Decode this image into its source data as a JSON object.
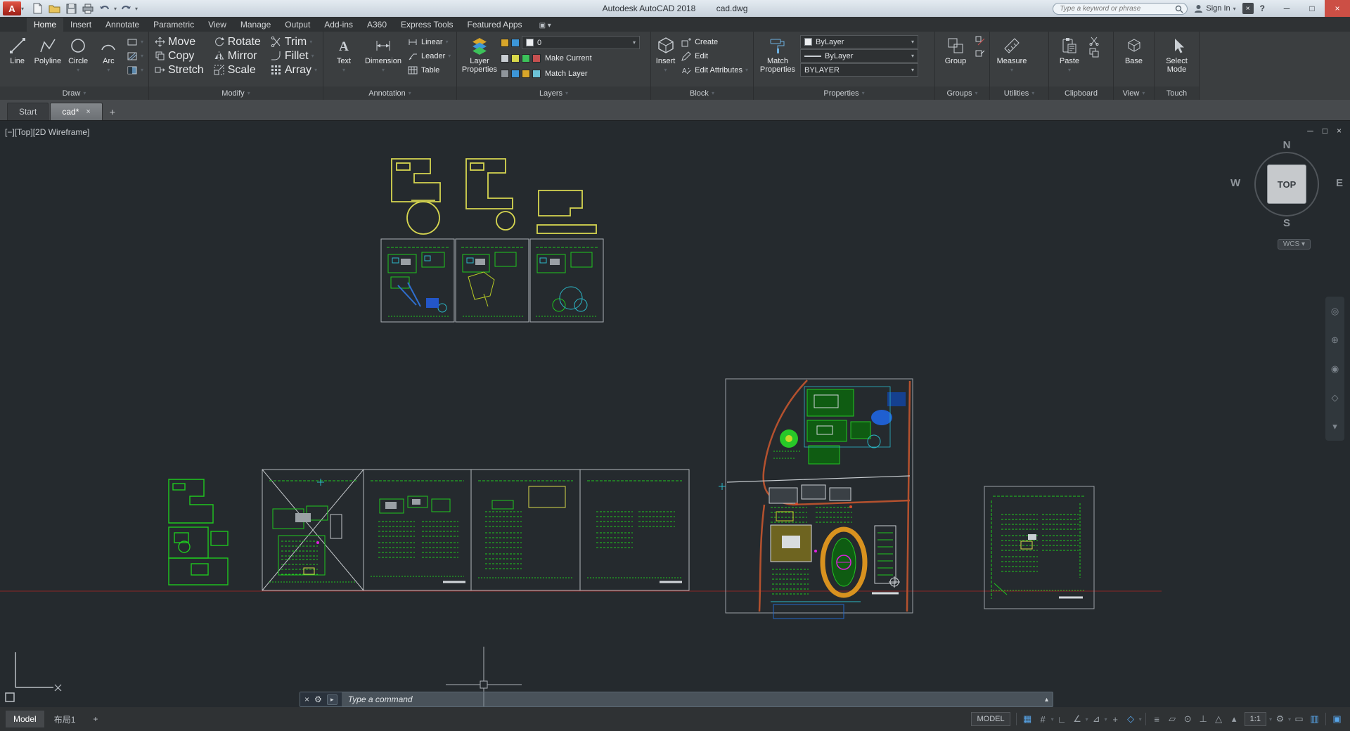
{
  "title_bar": {
    "logo": "A",
    "app_title": "Autodesk AutoCAD 2018",
    "doc_title": "cad.dwg",
    "search_placeholder": "Type a keyword or phrase",
    "sign_in_label": "Sign In",
    "help_label": "?"
  },
  "ribbon": {
    "tabs": [
      "Home",
      "Insert",
      "Annotate",
      "Parametric",
      "View",
      "Manage",
      "Output",
      "Add-ins",
      "A360",
      "Express Tools",
      "Featured Apps"
    ],
    "panels": {
      "draw": {
        "label": "Draw",
        "line": "Line",
        "polyline": "Polyline",
        "circle": "Circle",
        "arc": "Arc"
      },
      "modify": {
        "label": "Modify",
        "move": "Move",
        "rotate": "Rotate",
        "trim": "Trim",
        "copy": "Copy",
        "mirror": "Mirror",
        "fillet": "Fillet",
        "stretch": "Stretch",
        "scale": "Scale",
        "array": "Array"
      },
      "annotation": {
        "label": "Annotation",
        "text": "Text",
        "dimension": "Dimension",
        "linear": "Linear",
        "leader": "Leader",
        "table": "Table"
      },
      "layers": {
        "label": "Layers",
        "layer_properties": "Layer Properties",
        "make_current": "Make Current",
        "match_layer": "Match Layer",
        "current_layer": "0"
      },
      "block": {
        "label": "Block",
        "insert": "Insert",
        "create": "Create",
        "edit": "Edit",
        "edit_attributes": "Edit Attributes"
      },
      "properties": {
        "label": "Properties",
        "match_properties": "Match Properties",
        "color": "ByLayer",
        "linetype": "ByLayer",
        "lineweight": "BYLAYER"
      },
      "groups": {
        "label": "Groups",
        "group": "Group"
      },
      "utilities": {
        "label": "Utilities",
        "measure": "Measure"
      },
      "clipboard": {
        "label": "Clipboard",
        "paste": "Paste"
      },
      "view": {
        "label": "View",
        "base": "Base"
      },
      "touch": {
        "label": "Touch",
        "select_mode": "Select Mode"
      }
    }
  },
  "file_tabs": {
    "start": "Start",
    "document": "cad*",
    "close": "×",
    "add": "+"
  },
  "viewport": {
    "controls_label": "[−][Top][2D Wireframe]",
    "viewcube": {
      "north": "N",
      "east": "E",
      "south": "S",
      "west": "W",
      "face": "TOP"
    },
    "wcs_label": "WCS"
  },
  "command_line": {
    "prompt_placeholder": "Type a command"
  },
  "status_bar": {
    "model_tab": "Model",
    "layout_tab": "布局1",
    "add_layout": "+",
    "model_space_label": "MODEL",
    "annotation_scale": "1:1",
    "icons": [
      {
        "name": "grid-display",
        "glyph": "▦",
        "active": true
      },
      {
        "name": "snap-mode",
        "glyph": "#",
        "active": false
      },
      {
        "name": "ortho-mode",
        "glyph": "∟",
        "active": false
      },
      {
        "name": "polar-tracking",
        "glyph": "∠",
        "active": false
      },
      {
        "name": "isometric-drafting",
        "glyph": "⊿",
        "active": false
      },
      {
        "name": "object-snap-tracking",
        "glyph": "+",
        "active": false
      },
      {
        "name": "object-snap",
        "glyph": "◇",
        "active": true
      },
      {
        "name": "lineweight",
        "glyph": "≡",
        "active": false
      },
      {
        "name": "transparency",
        "glyph": "▱",
        "active": false
      },
      {
        "name": "selection-cycling",
        "glyph": "⊙",
        "active": false
      },
      {
        "name": "dynamic-ucs",
        "glyph": "⊥",
        "active": false
      },
      {
        "name": "annotation-visibility",
        "glyph": "△",
        "active": false
      },
      {
        "name": "autoscale",
        "glyph": "▴",
        "active": false
      },
      {
        "name": "workspace-switching",
        "glyph": "⚙",
        "active": false
      },
      {
        "name": "annotation-monitor",
        "glyph": "▭",
        "active": false
      },
      {
        "name": "graphics-performance",
        "glyph": "▥",
        "active": true
      },
      {
        "name": "clean-screen",
        "glyph": "▣",
        "active": true
      }
    ]
  }
}
